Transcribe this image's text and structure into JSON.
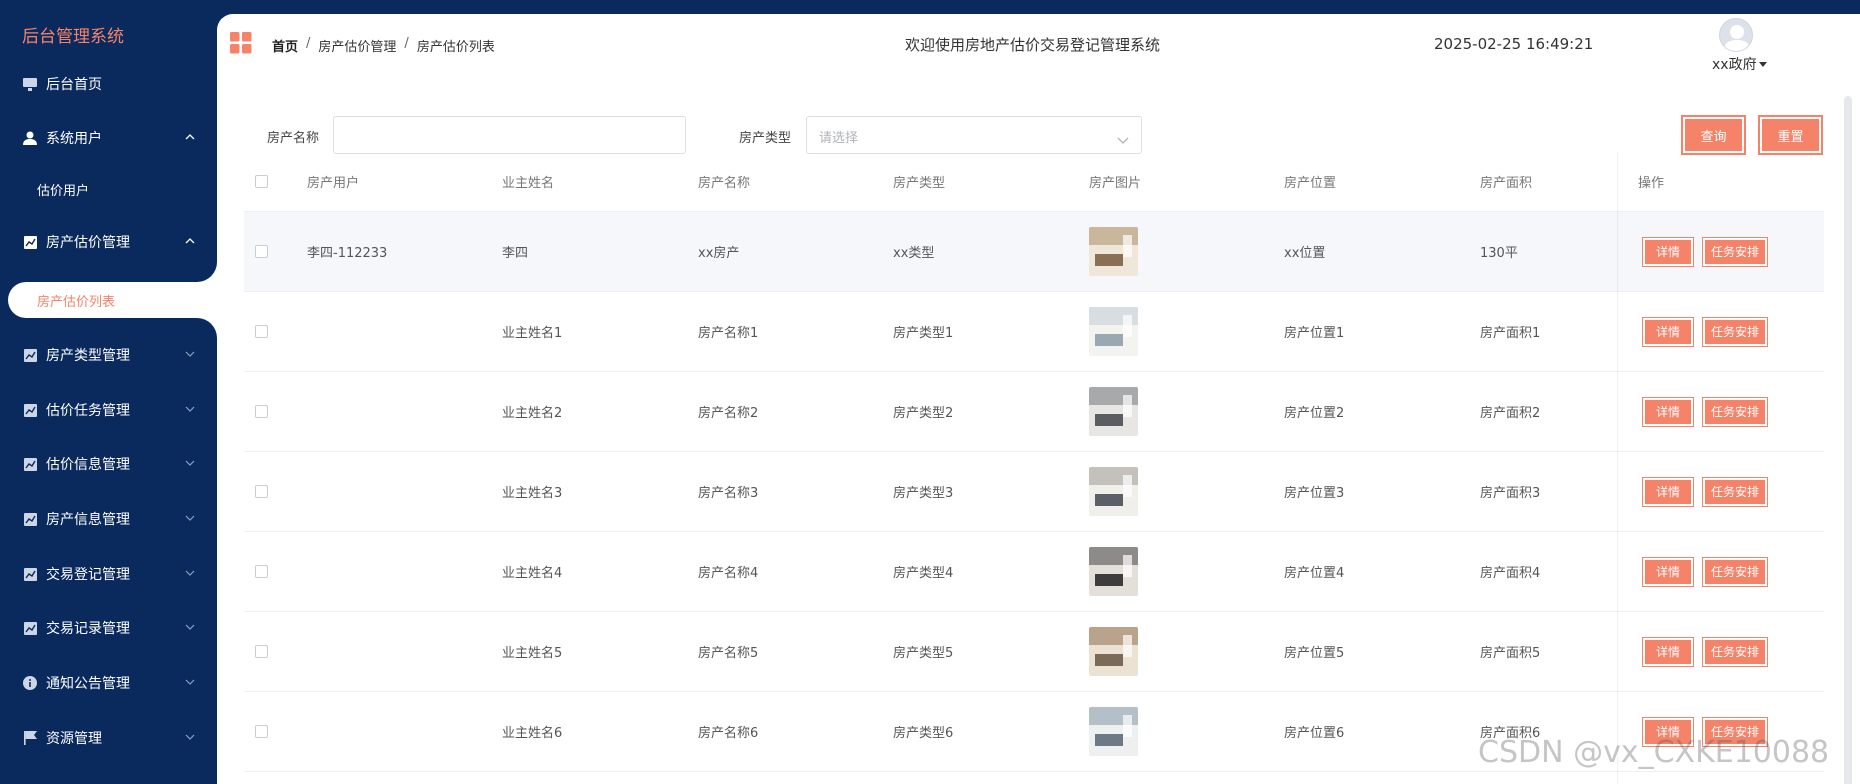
{
  "sidebar": {
    "title": "后台管理系统",
    "items": [
      {
        "label": "后台首页",
        "icon": "monitor-icon"
      },
      {
        "label": "系统用户",
        "icon": "user-icon",
        "arrow": "up"
      },
      {
        "label": "估价用户",
        "sub": true
      },
      {
        "label": "房产估价管理",
        "icon": "chart-icon",
        "arrow": "up"
      },
      {
        "label": "房产估价列表",
        "active": true
      },
      {
        "label": "房产类型管理",
        "icon": "chart-icon",
        "arrow": "down"
      },
      {
        "label": "估价任务管理",
        "icon": "chart-icon",
        "arrow": "down"
      },
      {
        "label": "估价信息管理",
        "icon": "chart-icon",
        "arrow": "down"
      },
      {
        "label": "房产信息管理",
        "icon": "chart-icon",
        "arrow": "down"
      },
      {
        "label": "交易登记管理",
        "icon": "chart-icon",
        "arrow": "down"
      },
      {
        "label": "交易记录管理",
        "icon": "chart-icon",
        "arrow": "down"
      },
      {
        "label": "通知公告管理",
        "icon": "info-icon",
        "arrow": "down"
      },
      {
        "label": "资源管理",
        "icon": "flag-icon",
        "arrow": "down"
      }
    ]
  },
  "header": {
    "breadcrumb": [
      "首页",
      "房产估价管理",
      "房产估价列表"
    ],
    "welcome": "欢迎使用房地产估价交易登记管理系统",
    "datetime": "2025-02-25 16:49:21",
    "username": "xx政府"
  },
  "filter": {
    "name_label": "房产名称",
    "name_value": "",
    "type_label": "房产类型",
    "type_placeholder": "请选择",
    "search_label": "查询",
    "reset_label": "重置"
  },
  "table": {
    "columns": [
      "房产用户",
      "业主姓名",
      "房产名称",
      "房产类型",
      "房产图片",
      "房产位置",
      "房产面积",
      "操作"
    ],
    "rows": [
      {
        "user": "李四-112233",
        "owner": "李四",
        "name": "xx房产",
        "type": "xx类型",
        "location": "xx位置",
        "area": "130平"
      },
      {
        "user": "",
        "owner": "业主姓名1",
        "name": "房产名称1",
        "type": "房产类型1",
        "location": "房产位置1",
        "area": "房产面积1"
      },
      {
        "user": "",
        "owner": "业主姓名2",
        "name": "房产名称2",
        "type": "房产类型2",
        "location": "房产位置2",
        "area": "房产面积2"
      },
      {
        "user": "",
        "owner": "业主姓名3",
        "name": "房产名称3",
        "type": "房产类型3",
        "location": "房产位置3",
        "area": "房产面积3"
      },
      {
        "user": "",
        "owner": "业主姓名4",
        "name": "房产名称4",
        "type": "房产类型4",
        "location": "房产位置4",
        "area": "房产面积4"
      },
      {
        "user": "",
        "owner": "业主姓名5",
        "name": "房产名称5",
        "type": "房产类型5",
        "location": "房产位置5",
        "area": "房产面积5"
      },
      {
        "user": "",
        "owner": "业主姓名6",
        "name": "房产名称6",
        "type": "房产类型6",
        "location": "房产位置6",
        "area": "房产面积6"
      }
    ],
    "detail_label": "详情",
    "task_label": "任务安排"
  },
  "watermark": "CSDN @vx_CXKE10088",
  "colors": {
    "sidebar_bg": "#0a2a5e",
    "accent": "#f5836a",
    "title": "#f5836a"
  }
}
